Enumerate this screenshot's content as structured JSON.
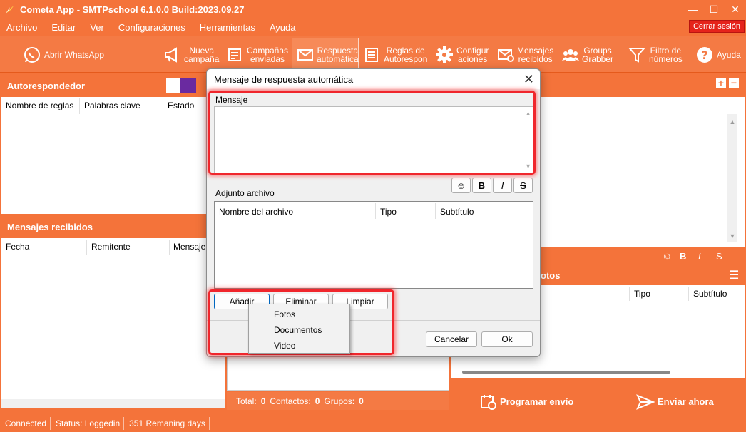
{
  "window": {
    "title": "Cometa App - SMTPschool 6.1.0.0 Build:2023.09.27"
  },
  "menu": [
    "Archivo",
    "Editar",
    "Ver",
    "Configuraciones",
    "Herramientas",
    "Ayuda"
  ],
  "logout_label": "Cerrar sesión",
  "toolbar": {
    "whatsapp": "Abrir WhatsApp",
    "nueva_1": "Nueva",
    "nueva_2": "campaña",
    "campanas_1": "Campañas",
    "campanas_2": "enviadas",
    "respuesta_1": "Respuesta",
    "respuesta_2": "automática",
    "reglas_1": "Reglas de",
    "reglas_2": "Autorespon",
    "config_1": "Configur",
    "config_2": "aciones",
    "mensajes_1": "Mensajes",
    "mensajes_2": "recibidos",
    "groups_1": "Groups",
    "groups_2": "Grabber",
    "filtro_1": "Filtro de",
    "filtro_2": "números",
    "ayuda": "Ayuda"
  },
  "left": {
    "autoresponder_title": "Autorespondedor",
    "rules_cols": [
      "Nombre de reglas",
      "Palabras clave",
      "Estado"
    ],
    "received_title": "Mensajes recibidos",
    "received_cols": [
      "Fecha",
      "Remitente",
      "Mensaje"
    ]
  },
  "right": {
    "fotos_partial": "otos",
    "cols": [
      "Tipo",
      "Subtítulo"
    ],
    "schedule_label": "Programar envío",
    "send_label": "Enviar ahora"
  },
  "totals": {
    "total_label": "Total:",
    "total": "0",
    "contactos_label": "Contactos:",
    "contactos": "0",
    "grupos_label": "Grupos:",
    "grupos": "0"
  },
  "status": [
    "Connected",
    "Status: Loggedin",
    "351 Remaning days"
  ],
  "dialog": {
    "title": "Mensaje de respuesta automática",
    "message_label": "Mensaje",
    "attachment_label": "Adjunto archivo",
    "attach_cols": [
      "Nombre del archivo",
      "Tipo",
      "Subtítulo"
    ],
    "add": "Añadir",
    "delete": "Eliminar",
    "clear": "Limpiar",
    "cancel": "Cancelar",
    "ok": "Ok",
    "fmt_bold": "B",
    "fmt_italic": "I",
    "fmt_strike": "S"
  },
  "add_menu": [
    "Fotos",
    "Documentos",
    "Video"
  ],
  "colors": {
    "accent": "#f4733a",
    "highlight": "#f0262c",
    "logout": "#e5231b"
  }
}
